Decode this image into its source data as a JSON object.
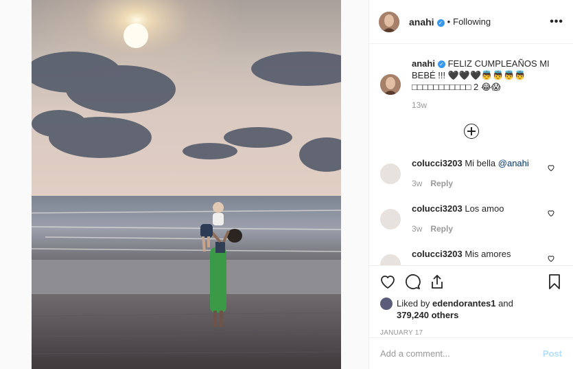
{
  "post": {
    "username": "anahi",
    "verified_glyph": "✓",
    "separator": "•",
    "follow_status": "Following",
    "more_glyph": "•••",
    "caption": {
      "username": "anahi",
      "text": "FELIZ CUMPLEAÑOS MI BEBÉ !!! 🖤🖤🖤👼👼👼👼□□□□□□□□□□□ 2 😂😱",
      "age": "13w"
    },
    "comments": [
      {
        "username": "colucci3203",
        "text": "Mi bella ",
        "mention": "@anahi",
        "age": "3w",
        "reply": "Reply"
      },
      {
        "username": "colucci3203",
        "text": "Los amoo",
        "mention": "",
        "age": "3w",
        "reply": "Reply"
      },
      {
        "username": "colucci3203",
        "text": "Mis amores",
        "mention": "",
        "age": "",
        "reply": ""
      }
    ],
    "likes": {
      "prefix": "Liked by ",
      "user": "edendorantes1",
      "middle": " and ",
      "count": "379,240 others"
    },
    "date": "JANUARY 17",
    "comment_placeholder": "Add a comment...",
    "post_label": "Post"
  },
  "icons": {
    "like": "heart-icon",
    "comment": "comment-icon",
    "share": "share-icon",
    "save": "bookmark-icon",
    "load_more": "plus-circle-icon"
  },
  "colors": {
    "verified": "#3897f0",
    "post_button_disabled": "#b2dffc",
    "meta_text": "#999999"
  }
}
